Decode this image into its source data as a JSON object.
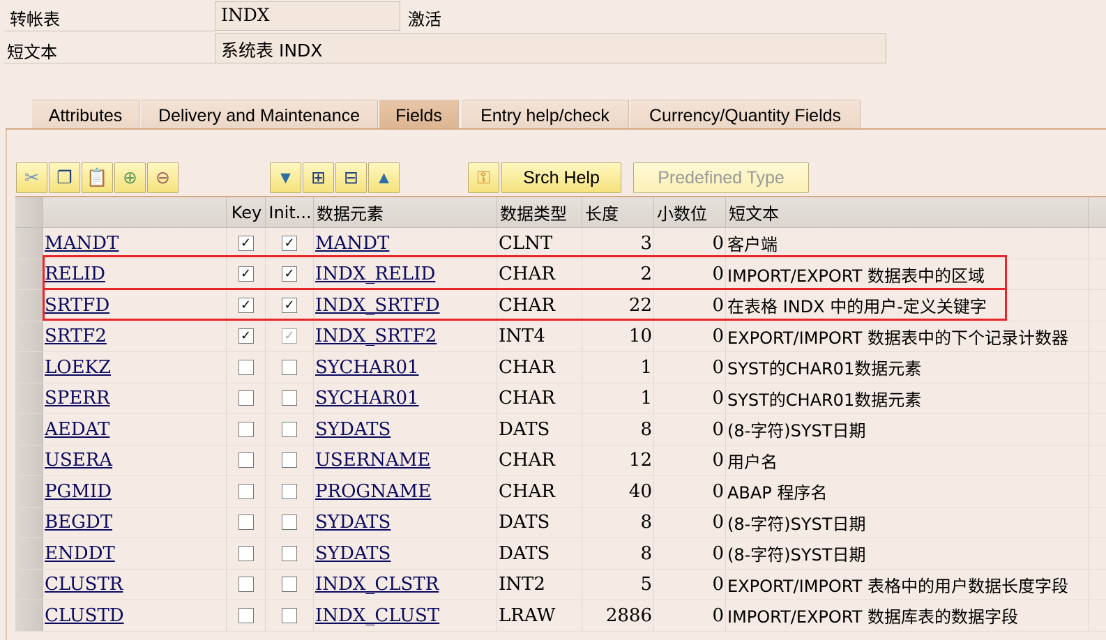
{
  "header": {
    "table_label": "转帐表",
    "table_value": "INDX",
    "status": "激活",
    "short_text_label": "短文本",
    "short_text_value": "系统表 INDX"
  },
  "tabs": [
    {
      "label": "Attributes"
    },
    {
      "label": "Delivery and Maintenance"
    },
    {
      "label": "Fields"
    },
    {
      "label": "Entry help/check"
    },
    {
      "label": "Currency/Quantity Fields"
    }
  ],
  "active_tab": "Fields",
  "toolbar": {
    "srch_help": "Srch Help",
    "predefined_type": "Predefined Type"
  },
  "columns": [
    "Key",
    "Init...",
    "数据元素",
    "数据类型",
    "长度",
    "小数位",
    "短文本"
  ],
  "rows": [
    {
      "field": "MANDT",
      "key": "✓",
      "init": "✓",
      "element": "MANDT",
      "type": "CLNT",
      "length": "3",
      "decimals": "0",
      "text": "客户端"
    },
    {
      "field": "RELID",
      "key": "✓",
      "init": "✓",
      "element": "INDX_RELID",
      "type": "CHAR",
      "length": "2",
      "decimals": "0",
      "text": "IMPORT/EXPORT 数据表中的区域"
    },
    {
      "field": "SRTFD",
      "key": "✓",
      "init": "✓",
      "element": "INDX_SRTFD",
      "type": "CHAR",
      "length": "22",
      "decimals": "0",
      "text": "在表格 INDX 中的用户-定义关键字"
    },
    {
      "field": "SRTF2",
      "key": "✓",
      "init": "✓",
      "element": "INDX_SRTF2",
      "type": "INT4",
      "length": "10",
      "decimals": "0",
      "text": "EXPORT/IMPORT 数据表中的下个记录计数器"
    },
    {
      "field": "LOEKZ",
      "key": "",
      "init": "",
      "element": "SYCHAR01",
      "type": "CHAR",
      "length": "1",
      "decimals": "0",
      "text": "SYST的CHAR01数据元素"
    },
    {
      "field": "SPERR",
      "key": "",
      "init": "",
      "element": "SYCHAR01",
      "type": "CHAR",
      "length": "1",
      "decimals": "0",
      "text": "SYST的CHAR01数据元素"
    },
    {
      "field": "AEDAT",
      "key": "",
      "init": "",
      "element": "SYDATS",
      "type": "DATS",
      "length": "8",
      "decimals": "0",
      "text": "(8-字符)SYST日期"
    },
    {
      "field": "USERA",
      "key": "",
      "init": "",
      "element": "USERNAME",
      "type": "CHAR",
      "length": "12",
      "decimals": "0",
      "text": "用户名"
    },
    {
      "field": "PGMID",
      "key": "",
      "init": "",
      "element": "PROGNAME",
      "type": "CHAR",
      "length": "40",
      "decimals": "0",
      "text": "ABAP 程序名"
    },
    {
      "field": "BEGDT",
      "key": "",
      "init": "",
      "element": "SYDATS",
      "type": "DATS",
      "length": "8",
      "decimals": "0",
      "text": "(8-字符)SYST日期"
    },
    {
      "field": "ENDDT",
      "key": "",
      "init": "",
      "element": "SYDATS",
      "type": "DATS",
      "length": "8",
      "decimals": "0",
      "text": "(8-字符)SYST日期"
    },
    {
      "field": "CLUSTR",
      "key": "",
      "init": "",
      "element": "INDX_CLSTR",
      "type": "INT2",
      "length": "5",
      "decimals": "0",
      "text": "EXPORT/IMPORT 表格中的用户数据长度字段"
    },
    {
      "field": "CLUSTD",
      "key": "",
      "init": "",
      "element": "INDX_CLUST",
      "type": "LRAW",
      "length": "2886",
      "decimals": "0",
      "text": "IMPORT/EXPORT 数据库表的数据字段"
    }
  ],
  "highlight_color": "#e8262a"
}
